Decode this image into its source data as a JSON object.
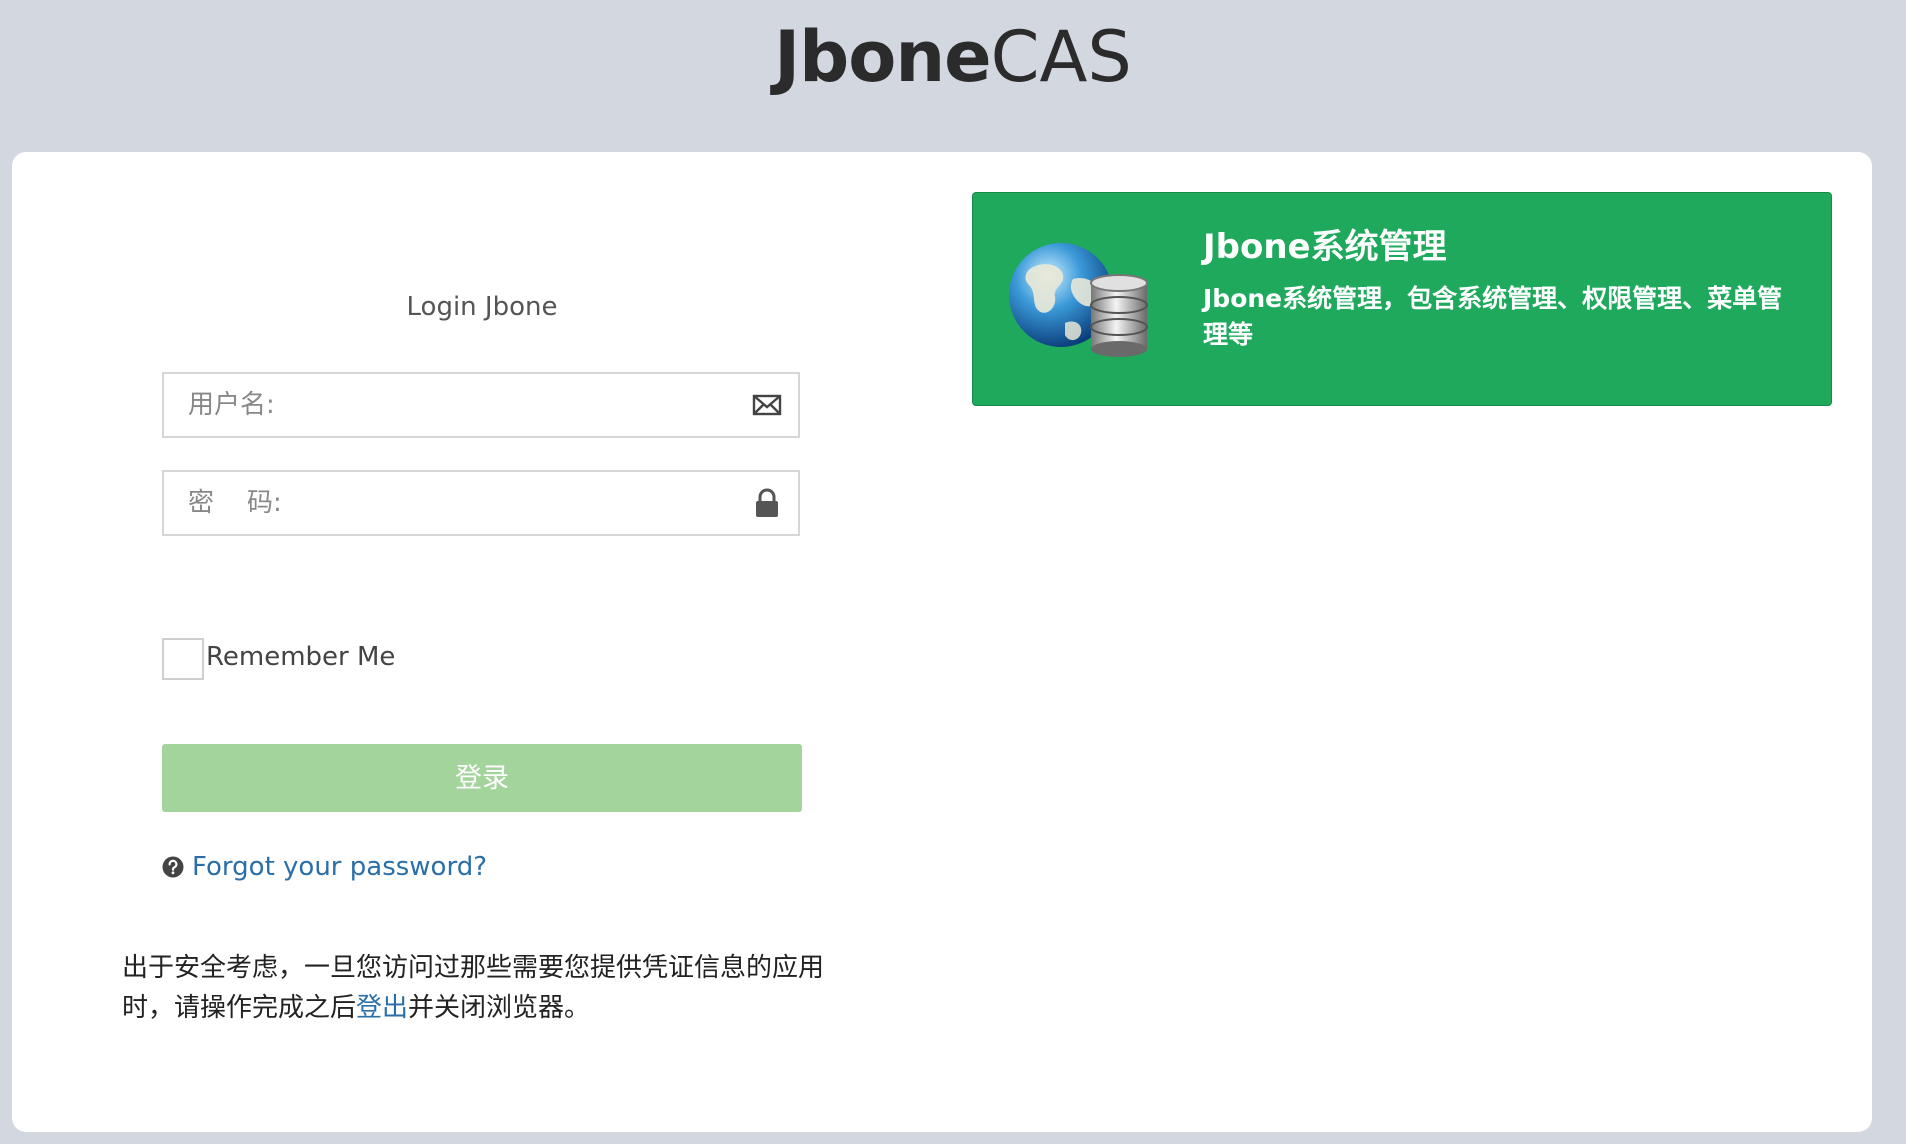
{
  "brand": {
    "bold": "Jbone",
    "light": "CAS"
  },
  "login": {
    "title": "Login Jbone",
    "username_placeholder": "用户名:",
    "password_placeholder": "密    码:",
    "remember_label": "Remember Me",
    "submit_label": "登录",
    "forgot_label": "Forgot your password?",
    "submit_color": "#a3d49b"
  },
  "security": {
    "text_before": "出于安全考虑，一旦您访问过那些需要您提供凭证信息的应用时，请操作完成之后",
    "logout_link": "登出",
    "text_after": "并关闭浏览器。"
  },
  "app": {
    "title": "Jbone系统管理",
    "description": "Jbone系统管理，包含系统管理、权限管理、菜单管理等",
    "icon": "globe-database-icon",
    "tile_color": "#1ea95c"
  },
  "link_color": "#2a6fa8"
}
